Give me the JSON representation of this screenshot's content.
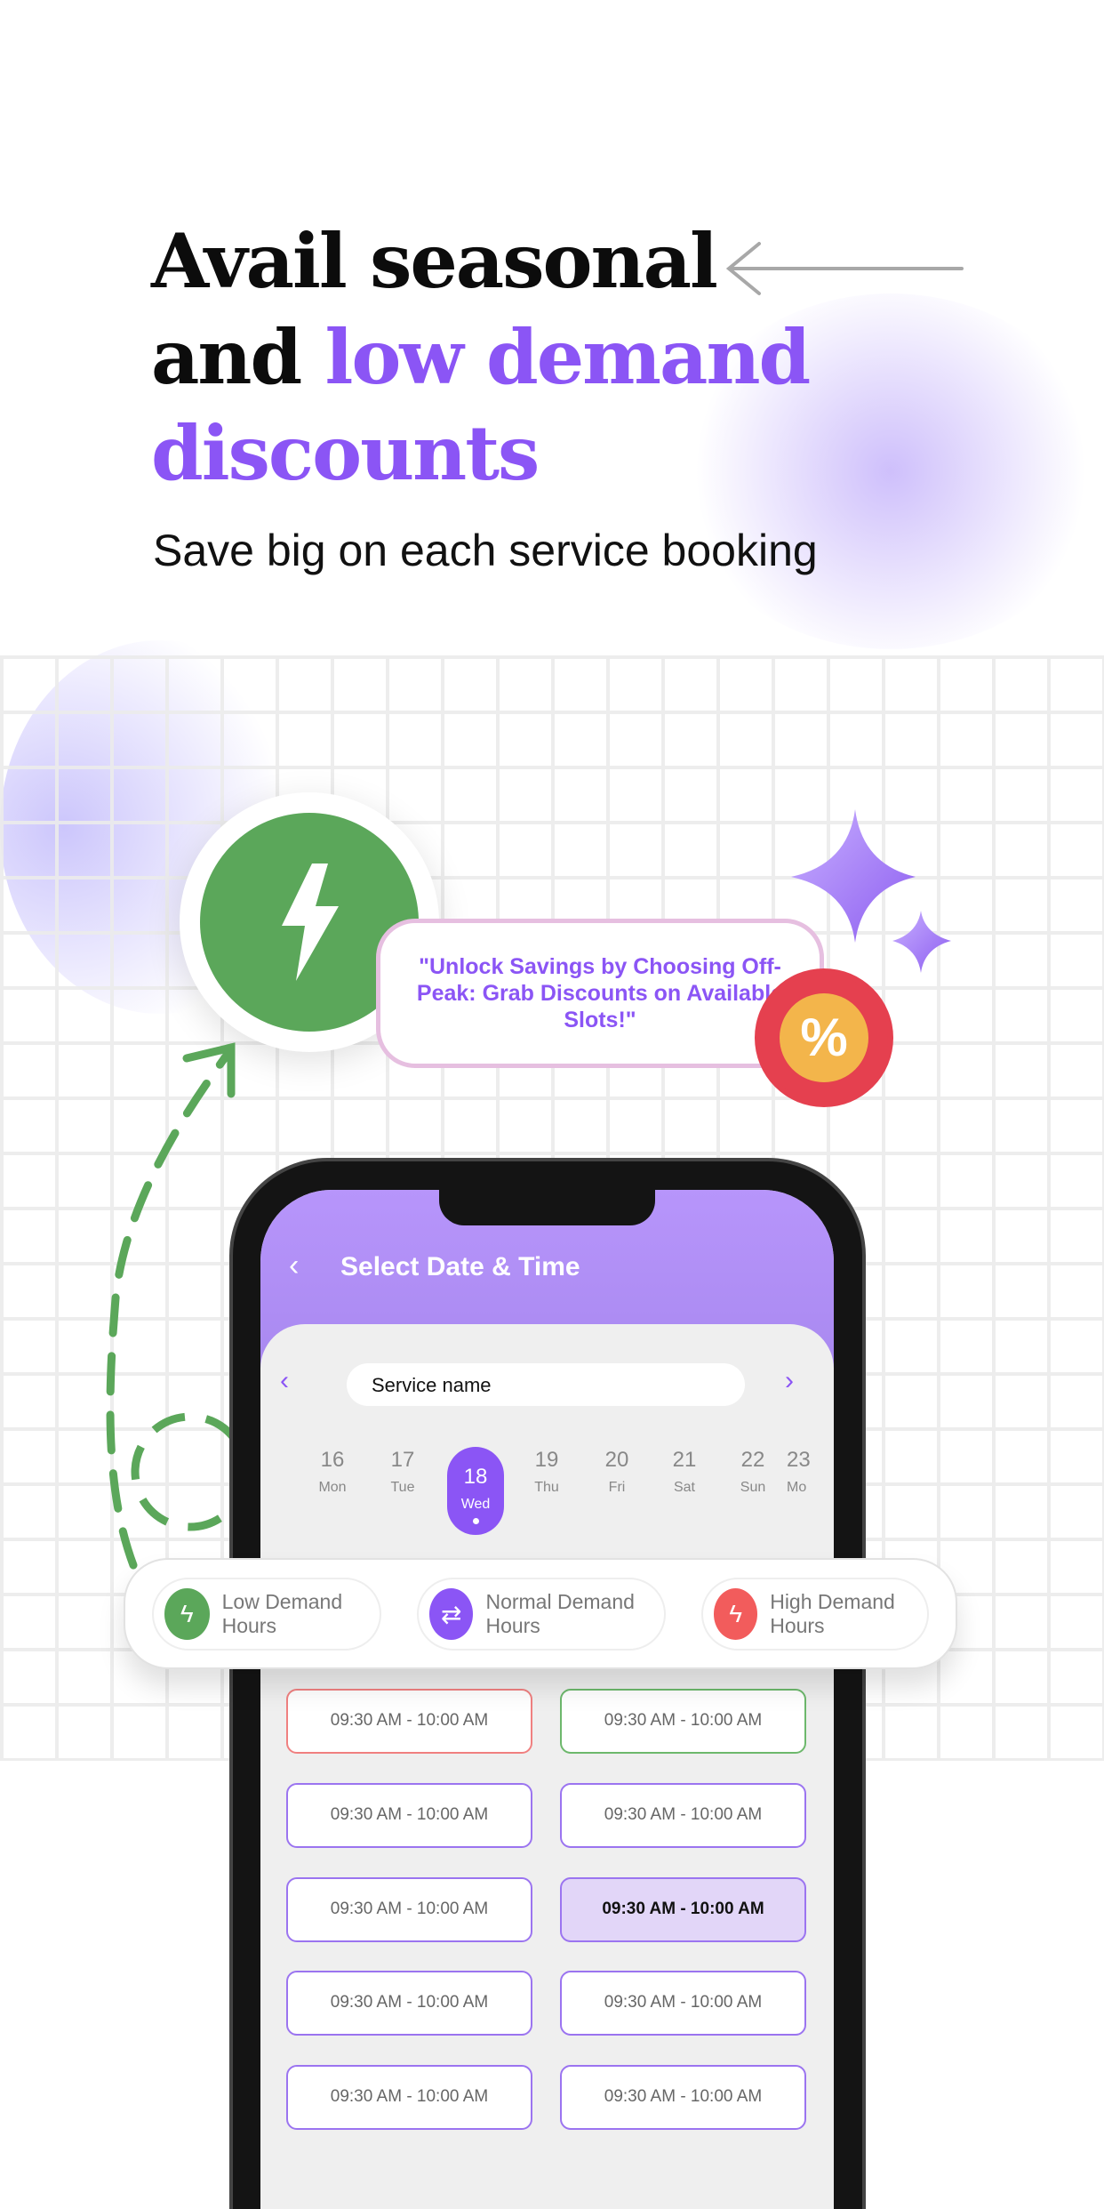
{
  "headline": {
    "line1": "Avail seasonal",
    "line2_plain": "and ",
    "line2_highlight": "low demand",
    "line3_highlight": "discounts"
  },
  "subtitle": "Save big on each service booking",
  "quote": "\"Unlock Savings by Choosing Off-Peak: Grab Discounts on Available Slots!\"",
  "badge_symbol": "%",
  "colors": {
    "accent": "#8b55f5",
    "low": "#5ba75a",
    "high": "#f25c5c",
    "header": "#b795fb"
  },
  "app": {
    "title": "Select Date & Time",
    "service_placeholder": "Service name",
    "dates": [
      {
        "n": "16",
        "d": "Mon"
      },
      {
        "n": "17",
        "d": "Tue"
      },
      {
        "n": "18",
        "d": "Wed",
        "selected": true
      },
      {
        "n": "19",
        "d": "Thu"
      },
      {
        "n": "20",
        "d": "Fri"
      },
      {
        "n": "21",
        "d": "Sat"
      },
      {
        "n": "22",
        "d": "Sun"
      },
      {
        "n": "23",
        "d": "Mo"
      }
    ]
  },
  "legend": [
    {
      "label": "Low Demand Hours",
      "icon": "bolt-icon"
    },
    {
      "label": "Normal Demand Hours",
      "icon": "arrows-icon"
    },
    {
      "label": "High Demand Hours",
      "icon": "bolt-icon"
    }
  ],
  "slots": [
    {
      "left": "09:30 AM - 10:00 AM",
      "right": "09:30 AM - 10:00 AM"
    },
    {
      "left": "09:30 AM - 10:00 AM",
      "right": "09:30 AM - 10:00 AM"
    },
    {
      "left": "09:30 AM - 10:00 AM",
      "right": "09:30 AM - 10:00 AM"
    },
    {
      "left": "09:30 AM - 10:00 AM",
      "right": "09:30 AM - 10:00 AM"
    },
    {
      "left": "09:30 AM - 10:00 AM",
      "right": "09:30 AM - 10:00 AM"
    }
  ]
}
